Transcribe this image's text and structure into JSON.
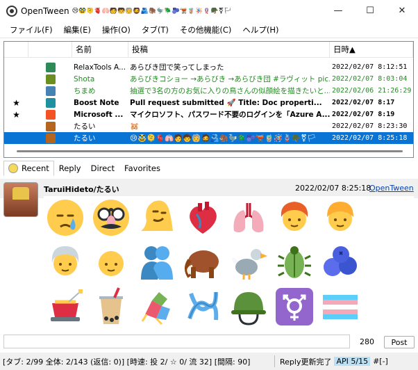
{
  "window": {
    "title": "OpenTween",
    "title_emoji": "😢🥸🫠🫀🫁🧑🧒🧓🧔🫂🦣🦤🪲🫐🫕🧋🪅🪢🪖⚧🏳"
  },
  "menu": [
    "ファイル(F)",
    "編集(E)",
    "操作(O)",
    "タブ(T)",
    "その他機能(C)",
    "ヘルプ(H)"
  ],
  "timeline": {
    "headers": {
      "name": "名前",
      "post": "投稿",
      "date": "日時▲"
    },
    "rows": [
      {
        "star": "",
        "name": "RelaxTools A...",
        "text": "あらびき団で笑ってしまった",
        "date": "2022/02/07 8:12:51",
        "icon_color": "#2e8b57",
        "style": "normal"
      },
      {
        "star": "",
        "name": "Shota",
        "text": "あらびきコショー →あらびき →あらびき団 #ラヴィット pic.twi...",
        "date": "2022/02/07 8:03:04",
        "icon_color": "#6b8e23",
        "style": "green"
      },
      {
        "star": "",
        "name": "ちまめ",
        "text": "抽選で3名の方のお気に入りの鳥さんの似顔絵を描きたいと...",
        "date": "2022/02/06 21:26:29",
        "icon_color": "#4682b4",
        "style": "green"
      },
      {
        "star": "★",
        "name": "Boost Note",
        "text": "Pull request submitted 🚀 Title: Doc properti...",
        "date": "2022/02/07 8:17",
        "icon_color": "#1e90a0",
        "style": "bold"
      },
      {
        "star": "★",
        "name": "Microsoft ...",
        "text": "マイクロソフト、パスワード不要のログインを「Azure A...",
        "date": "2022/02/07 8:19",
        "icon_color": "#f35325",
        "style": "bold"
      },
      {
        "star": "",
        "name": "たるい",
        "text": "🐹",
        "date": "2022/02/07 8:23:30",
        "icon_color": "#b5651d",
        "style": "normal"
      },
      {
        "star": "",
        "name": "たるい",
        "text": "😢🥸🫠🫀🫁🧑🧒🧓🧔🫂🦣🦤🪲🫐🫕🧋🪅🪢🪖⚧🏳",
        "date": "2022/02/07 8:25:18",
        "icon_color": "#b5651d",
        "style": "selected"
      }
    ]
  },
  "tabs": [
    "Recent",
    "Reply",
    "Direct",
    "Favorites"
  ],
  "detail": {
    "name": "TaruiHideto/たるい",
    "date": "2022/02/07 8:25:18",
    "via": "OpenTween",
    "emojis": [
      "face-holding-back-tears",
      "disguised-face",
      "melting-face",
      "anatomical-heart",
      "lungs",
      "person-red-hair",
      "person-curly-hair",
      "older-person",
      "bald-person",
      "people-hugging",
      "mammoth",
      "dodo",
      "beetle",
      "blueberries",
      "fondue",
      "bubble-tea",
      "pinata",
      "knot",
      "military-helmet",
      "transgender-symbol",
      "transgender-flag"
    ]
  },
  "postbox": {
    "count": "280",
    "post_label": "Post"
  },
  "status": {
    "main": "[タブ: 2/99 全体: 2/143 (返信: 0)] [時速: 投 2/ ☆ 0/ 流 32] [間隔: 90]",
    "reply": "Reply更新完了",
    "api": "API 5/15",
    "rate": "#[-]"
  },
  "colors": {
    "selection": "#0a74d4",
    "green_text": "#228b22",
    "link": "#0645ad"
  }
}
